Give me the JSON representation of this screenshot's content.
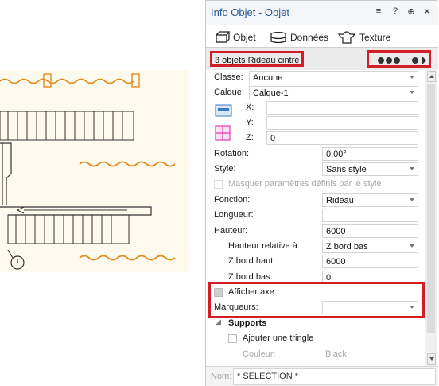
{
  "palette": {
    "title": "Info Objet - Objet",
    "controls": {
      "menu": "≡",
      "help": "?",
      "pin": "⊕",
      "close": "✕"
    },
    "tabs": [
      {
        "label": "Objet",
        "icon": "object-icon"
      },
      {
        "label": "Données",
        "icon": "data-icon"
      },
      {
        "label": "Texture",
        "icon": "texture-icon"
      }
    ],
    "selection": {
      "label": "3 objets Rideau cintré"
    },
    "properties": {
      "classe": {
        "label": "Classe:",
        "value": "Aucune"
      },
      "calque": {
        "label": "Calque:",
        "value": "Calque-1"
      },
      "x": {
        "label": "X:",
        "value": ""
      },
      "y": {
        "label": "Y:",
        "value": ""
      },
      "z": {
        "label": "Z:",
        "value": "0"
      },
      "rotation": {
        "label": "Rotation:",
        "value": "0,00°"
      },
      "style": {
        "label": "Style:",
        "value": "Sans style"
      },
      "masquer": {
        "label": "Masquer paramètres définis par le style"
      },
      "fonction": {
        "label": "Fonction:",
        "value": "Rideau"
      },
      "longueur": {
        "label": "Longueur:",
        "value": ""
      },
      "hauteur": {
        "label": "Hauteur:",
        "value": "6000"
      },
      "hauteur_rel": {
        "label": "Hauteur relative à:",
        "value": "Z bord bas"
      },
      "z_haut": {
        "label": "Z bord haut:",
        "value": "6000"
      },
      "z_bas": {
        "label": "Z bord bas:",
        "value": "0"
      },
      "afficher_axe": {
        "label": "Afficher axe"
      },
      "marqueurs": {
        "label": "Marqueurs:",
        "value": ""
      },
      "supports": {
        "label": "Supports"
      },
      "tringle": {
        "label": "Ajouter une tringle"
      },
      "couleur": {
        "label": "Couleur:",
        "value": "Black"
      }
    },
    "nom": {
      "label": "Nom:",
      "value": "* SELECTION *"
    }
  },
  "colors": {
    "accent_red": "#d21f26",
    "title_blue": "#2a5a96",
    "curtain_orange": "#e08a1f",
    "stair_dark": "#333333"
  }
}
